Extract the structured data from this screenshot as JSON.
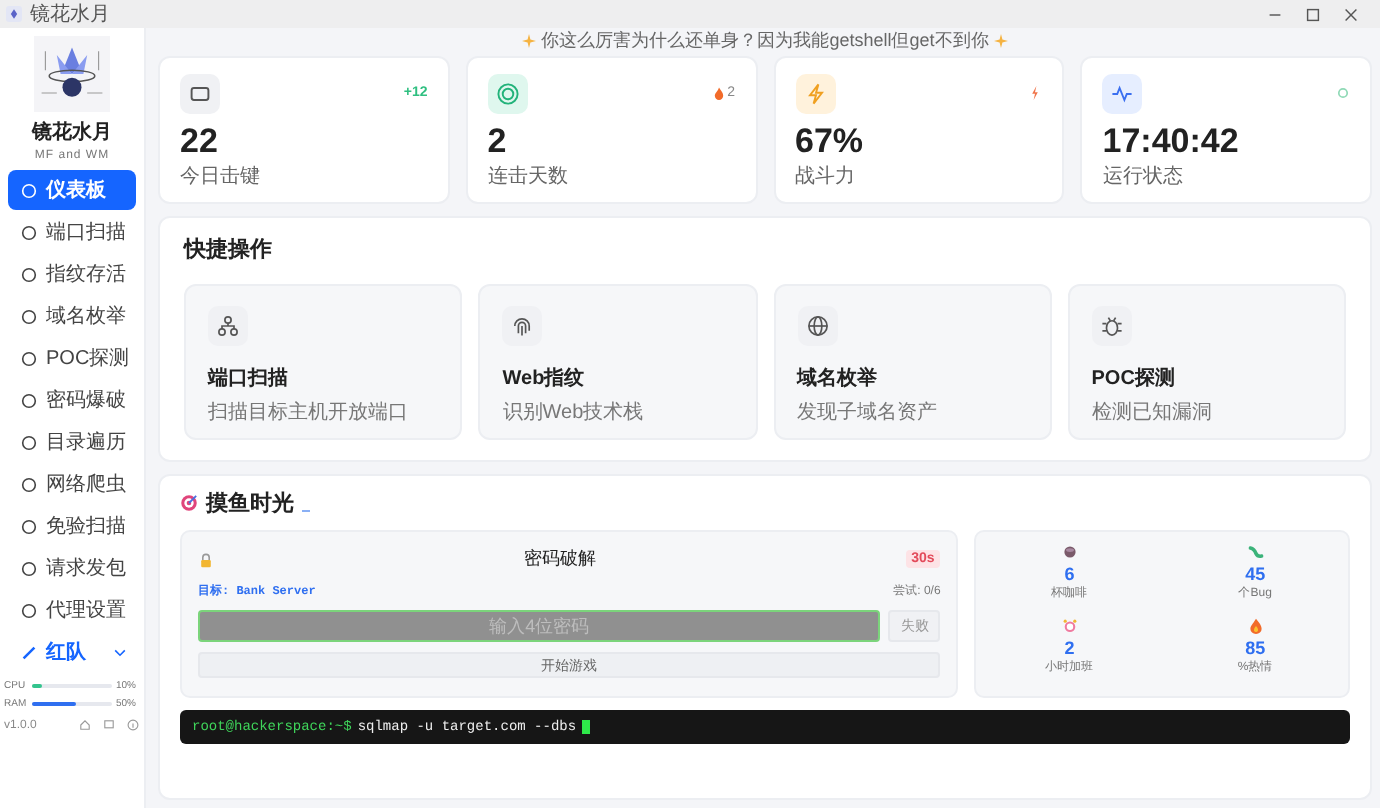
{
  "window": {
    "title": "镜花水月"
  },
  "sidebar": {
    "name": "镜花水月",
    "subtitle": "MF and WM",
    "items": [
      {
        "label": "仪表板",
        "selected": true
      },
      {
        "label": "端口扫描",
        "selected": false
      },
      {
        "label": "指纹存活",
        "selected": false
      },
      {
        "label": "域名枚举",
        "selected": false
      },
      {
        "label": "POC探测",
        "selected": false
      },
      {
        "label": "密码爆破",
        "selected": false
      },
      {
        "label": "目录遍历",
        "selected": false
      },
      {
        "label": "网络爬虫",
        "selected": false
      },
      {
        "label": "免验扫描",
        "selected": false
      },
      {
        "label": "请求发包",
        "selected": false
      },
      {
        "label": "代理设置",
        "selected": false
      }
    ],
    "group": {
      "label": "红队",
      "expanded": false
    },
    "meters": [
      {
        "name": "CPU",
        "level": 0.12,
        "reading": "10%"
      },
      {
        "name": "RAM",
        "level": 0.55,
        "reading": "50%"
      }
    ],
    "version": "v1.0.0"
  },
  "banner": "你这么厉害为什么还单身？因为我能getshell但get不到你",
  "stats": [
    {
      "value": "22",
      "label": "今日击键",
      "badge": "+12"
    },
    {
      "value": "2",
      "label": "连击天数",
      "badge": "2"
    },
    {
      "value": "67%",
      "label": "战斗力"
    },
    {
      "value": "17:40:42",
      "label": "运行状态"
    }
  ],
  "quick_actions": {
    "title": "快捷操作",
    "items": [
      {
        "title": "端口扫描",
        "desc": "扫描目标主机开放端口"
      },
      {
        "title": "Web指纹",
        "desc": "识别Web技术栈"
      },
      {
        "title": "域名枚举",
        "desc": "发现子域名资产"
      },
      {
        "title": "POC探测",
        "desc": "检测已知漏洞"
      }
    ]
  },
  "fun": {
    "title": "摸鱼时光",
    "game": {
      "title": "密码破解",
      "timer": "30s",
      "target_label": "目标:",
      "target": "Bank Server",
      "attempts": "尝试: 0/6",
      "placeholder": "输入4位密码",
      "submit": "失败",
      "start": "开始游戏"
    },
    "stats": [
      {
        "value": "6",
        "label": "杯咖啡"
      },
      {
        "value": "45",
        "label": "个Bug"
      },
      {
        "value": "2",
        "label": "小时加班"
      },
      {
        "value": "85",
        "label": "%热情"
      }
    ],
    "terminal": {
      "prompt": "root@hackerspace:~$",
      "command": "sqlmap -u target.com --dbs"
    }
  }
}
